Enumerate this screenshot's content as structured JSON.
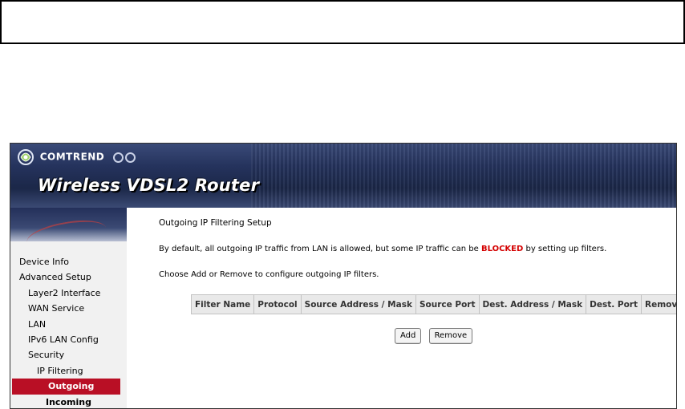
{
  "brand": {
    "logo_text": "COMTREND",
    "product_title": "Wireless VDSL2 Router"
  },
  "sidebar": {
    "items": [
      {
        "label": "Device Info"
      },
      {
        "label": "Advanced Setup"
      },
      {
        "label": "Layer2 Interface"
      },
      {
        "label": "WAN Service"
      },
      {
        "label": "LAN"
      },
      {
        "label": "IPv6 LAN Config"
      },
      {
        "label": "Security"
      },
      {
        "label": "IP Filtering"
      },
      {
        "label": "Outgoing"
      },
      {
        "label": "Incoming"
      }
    ],
    "active_color": "#b90f25"
  },
  "main": {
    "heading": "Outgoing IP Filtering Setup",
    "para1_before": "By default, all outgoing IP traffic from LAN is allowed, but some IP traffic can be ",
    "para1_blocked": "BLOCKED",
    "para1_after": " by setting up filters.",
    "para2": "Choose Add or Remove to configure outgoing IP filters.",
    "table_headers": [
      "Filter Name",
      "Protocol",
      "Source Address / Mask",
      "Source Port",
      "Dest. Address / Mask",
      "Dest. Port",
      "Remove"
    ],
    "add_button": "Add",
    "remove_button": "Remove"
  }
}
